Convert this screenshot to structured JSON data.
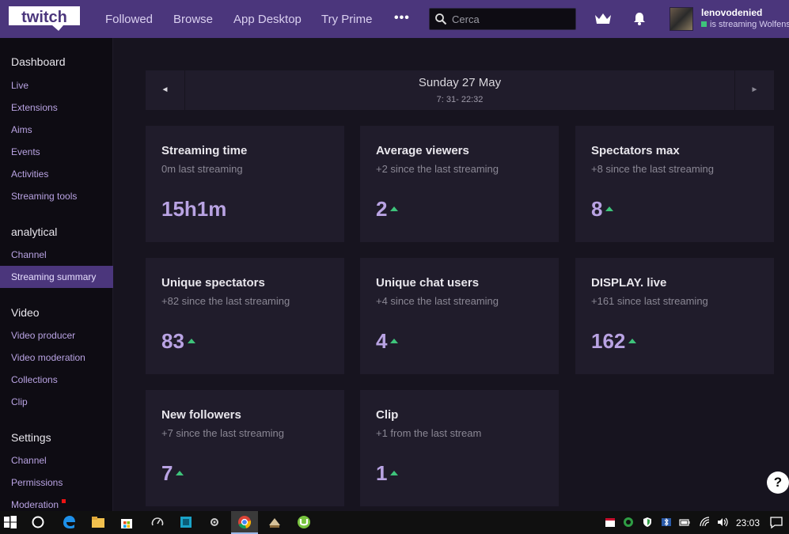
{
  "nav": {
    "links": [
      "Followed",
      "Browse",
      "App Desktop",
      "Try Prime"
    ],
    "more": "•••",
    "search_placeholder": "Cerca",
    "username": "lenovodenied",
    "status": "is streaming Wolfens"
  },
  "sidebar": {
    "sections": [
      {
        "title": "Dashboard",
        "items": [
          "Live",
          "Extensions",
          "Aims",
          "Events",
          "Activities",
          "Streaming tools"
        ]
      },
      {
        "title": "analytical",
        "items": [
          "Channel",
          "Streaming summary"
        ]
      },
      {
        "title": "Video",
        "items": [
          "Video producer",
          "Video moderation",
          "Collections",
          "Clip"
        ]
      },
      {
        "title": "Settings",
        "items": [
          "Channel",
          "Permissions",
          "Moderation"
        ]
      }
    ],
    "active_item": "Streaming summary"
  },
  "date_bar": {
    "prev": "◄",
    "next": "►",
    "title": "Sunday 27 May",
    "range": "7: 31- 22:32"
  },
  "stats": [
    {
      "title": "Streaming time",
      "sub": "0m last streaming",
      "value": "15h1m",
      "trend": "none"
    },
    {
      "title": "Average viewers",
      "sub": "+2 since the last streaming",
      "value": "2",
      "trend": "up"
    },
    {
      "title": "Spectators max",
      "sub": "+8 since the last streaming",
      "value": "8",
      "trend": "up"
    },
    {
      "title": "Unique spectators",
      "sub": "+82 since the last streaming",
      "value": "83",
      "trend": "up"
    },
    {
      "title": "Unique chat users",
      "sub": "+4 since the last streaming",
      "value": "4",
      "trend": "up"
    },
    {
      "title": "DISPLAY. live",
      "sub": "+161 since last streaming",
      "value": "162",
      "trend": "up"
    },
    {
      "title": "New followers",
      "sub": "+7 since the last streaming",
      "value": "7",
      "trend": "up"
    },
    {
      "title": "Clip",
      "sub": "+1 from the last stream",
      "value": "1",
      "trend": "up"
    }
  ],
  "help": "?",
  "taskbar": {
    "clock": "23:03"
  },
  "colors": {
    "brand": "#4b367c",
    "accent": "#b9a3e3",
    "up": "#3ec47b",
    "card": "#201c2b",
    "background": "#17141f"
  }
}
